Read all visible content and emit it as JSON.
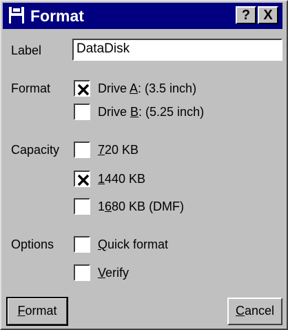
{
  "dialog": {
    "title": "Format",
    "help_button": "?",
    "close_button": "X"
  },
  "label_field": {
    "label": "Label",
    "value": "DataDisk"
  },
  "format_group": {
    "label": "Format",
    "options": [
      {
        "pre": "Drive ",
        "key": "A",
        "post": ": (3.5 inch)",
        "checked": true
      },
      {
        "pre": "Drive ",
        "key": "B",
        "post": ": (5.25 inch)",
        "checked": false
      }
    ]
  },
  "capacity_group": {
    "label": "Capacity",
    "options": [
      {
        "pre": "",
        "key": "7",
        "post": "20 KB",
        "checked": false
      },
      {
        "pre": "",
        "key": "1",
        "post": "440 KB",
        "checked": true
      },
      {
        "pre": "1",
        "key": "6",
        "post": "80 KB (DMF)",
        "checked": false
      }
    ]
  },
  "options_group": {
    "label": "Options",
    "options": [
      {
        "pre": "",
        "key": "Q",
        "post": "uick format",
        "checked": false
      },
      {
        "pre": "",
        "key": "V",
        "post": "erify",
        "checked": false
      }
    ]
  },
  "buttons": {
    "format": {
      "key": "F",
      "rest": "ormat"
    },
    "cancel": {
      "key": "C",
      "rest": "ancel"
    }
  },
  "colors": {
    "titlebar": "#000080",
    "face": "#c0c0c0"
  }
}
